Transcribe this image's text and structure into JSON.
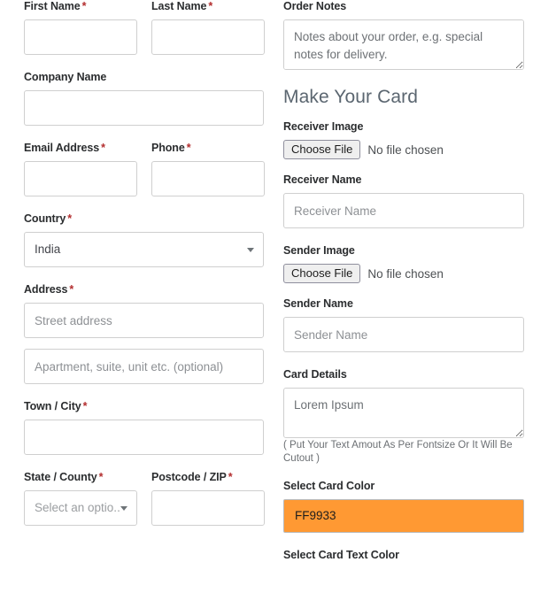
{
  "billing": {
    "first_name": {
      "label": "First Name",
      "required": true,
      "value": "",
      "placeholder": ""
    },
    "last_name": {
      "label": "Last Name",
      "required": true,
      "value": "",
      "placeholder": ""
    },
    "company_name": {
      "label": "Company Name",
      "required": false,
      "value": "",
      "placeholder": ""
    },
    "email": {
      "label": "Email Address",
      "required": true,
      "value": "",
      "placeholder": ""
    },
    "phone": {
      "label": "Phone",
      "required": true,
      "value": "",
      "placeholder": ""
    },
    "country": {
      "label": "Country",
      "required": true,
      "value": "India"
    },
    "address": {
      "label": "Address",
      "required": true
    },
    "address_line1_placeholder": "Street address",
    "address_line2_placeholder": "Apartment, suite, unit etc. (optional)",
    "town_city": {
      "label": "Town / City",
      "required": true,
      "value": "",
      "placeholder": ""
    },
    "state_county": {
      "label": "State / County",
      "required": true,
      "value": "Select an optio.."
    },
    "postcode_zip": {
      "label": "Postcode / ZIP",
      "required": true,
      "value": "",
      "placeholder": ""
    }
  },
  "order": {
    "notes_label": "Order Notes",
    "notes_placeholder": "Notes about your order, e.g. special notes for delivery.",
    "notes_value": ""
  },
  "make_card": {
    "section_title": "Make Your Card",
    "receiver_image": {
      "label": "Receiver Image",
      "button": "Choose File",
      "status": "No file chosen"
    },
    "receiver_name": {
      "label": "Receiver Name",
      "placeholder": "Receiver Name",
      "value": ""
    },
    "sender_image": {
      "label": "Sender Image",
      "button": "Choose File",
      "status": "No file chosen"
    },
    "sender_name": {
      "label": "Sender Name",
      "placeholder": "Sender Name",
      "value": ""
    },
    "card_details": {
      "label": "Card Details",
      "placeholder": "Lorem Ipsum",
      "value": ""
    },
    "card_details_hint": "( Put Your Text Amout As Per Fontsize Or It Will Be Cutout )",
    "card_color": {
      "label": "Select Card Color",
      "value": "FF9933",
      "hex": "#FF9933"
    },
    "card_text_color": {
      "label": "Select Card Text Color"
    }
  },
  "icons": {
    "chevron_down": "chevron-down-icon",
    "resize_handle": "resize-handle-icon"
  }
}
